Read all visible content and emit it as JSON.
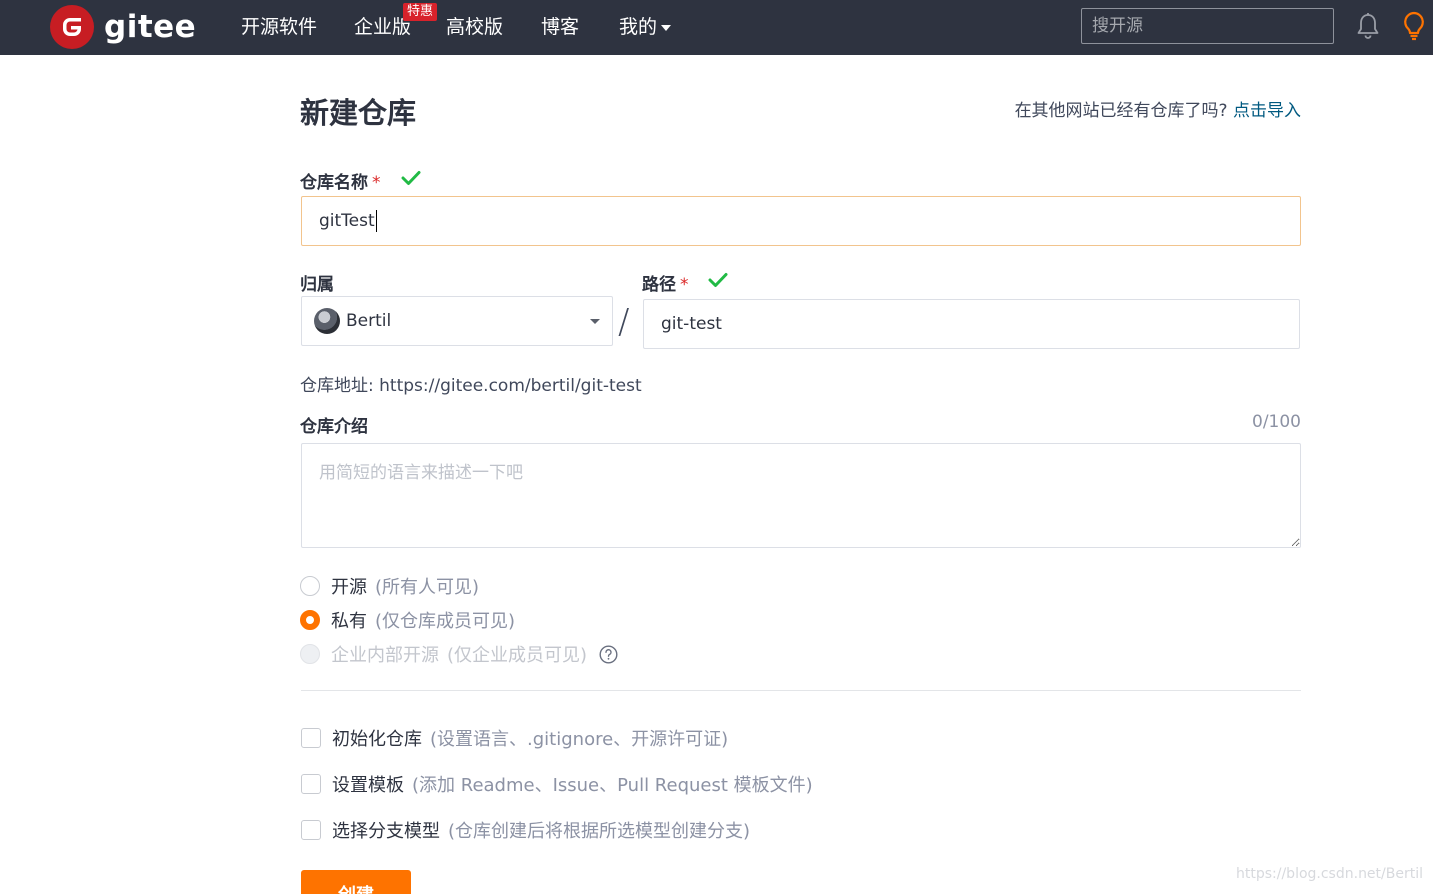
{
  "nav": {
    "brand": "gitee",
    "items": [
      "开源软件",
      "企业版",
      "高校版",
      "博客",
      "我的"
    ],
    "enterprise_badge": "特惠",
    "search_placeholder": "搜开源"
  },
  "main": {
    "title": "新建仓库",
    "import_prompt": "在其他网站已经有仓库了吗?",
    "import_link": "点击导入",
    "repo_name": {
      "label": "仓库名称",
      "required_mark": "*",
      "value": "gitTest"
    },
    "owner": {
      "label": "归属",
      "value": "Bertil"
    },
    "path": {
      "label": "路径",
      "required_mark": "*",
      "value": "git-test"
    },
    "slash": "/",
    "repo_url": "仓库地址: https://gitee.com/bertil/git-test",
    "description": {
      "label": "仓库介绍",
      "counter": "0/100",
      "placeholder": "用简短的语言来描述一下吧"
    },
    "visibility": [
      {
        "label": "开源",
        "hint": "(所有人可见)",
        "state": "unchecked"
      },
      {
        "label": "私有",
        "hint": "(仅仓库成员可见)",
        "state": "checked"
      },
      {
        "label": "企业内部开源",
        "hint": "(仅企业成员可见)",
        "state": "disabled"
      }
    ],
    "options": [
      {
        "label": "初始化仓库",
        "hint": "(设置语言、.gitignore、开源许可证)"
      },
      {
        "label": "设置模板",
        "hint": "(添加 Readme、Issue、Pull Request 模板文件)"
      },
      {
        "label": "选择分支模型",
        "hint": "(仓库创建后将根据所选模型创建分支)"
      }
    ],
    "create_button": "创建"
  },
  "watermark": "https://blog.csdn.net/Bertil",
  "colors": {
    "nav_bg": "#2e3340",
    "accent": "#fe7300",
    "brand_red": "#c71d23",
    "link": "#005980",
    "valid_check": "#21ba45"
  }
}
